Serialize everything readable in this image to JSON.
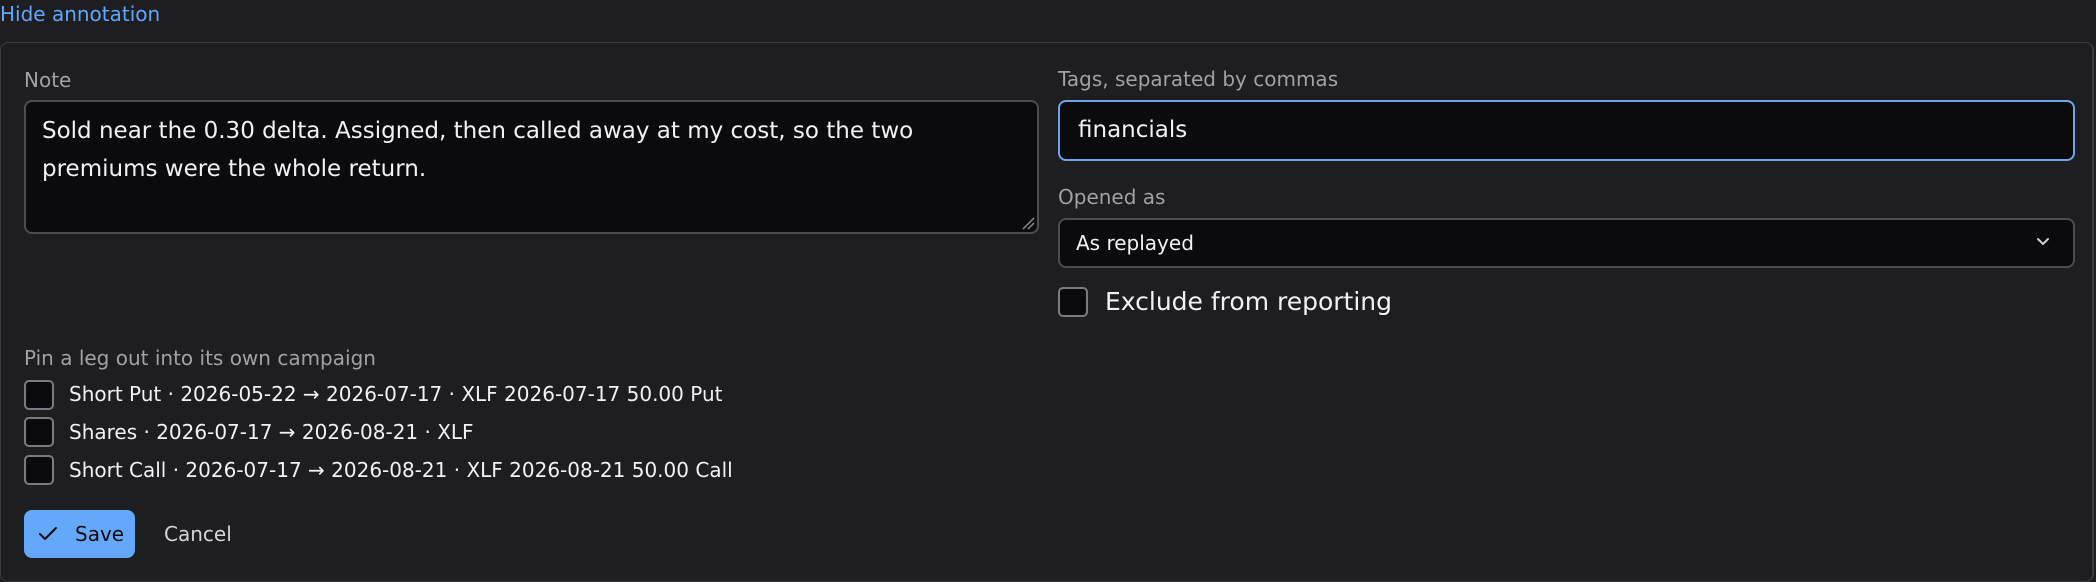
{
  "annotation": {
    "toggle_label": "Hide annotation"
  },
  "note": {
    "label": "Note",
    "value": "Sold near the 0.30 delta. Assigned, then called away at my cost, so the two premiums were the whole return."
  },
  "tags": {
    "label": "Tags, separated by commas",
    "value": "financials"
  },
  "opened_as": {
    "label": "Opened as",
    "selected": "As replayed"
  },
  "exclude": {
    "label": "Exclude from reporting",
    "checked": false
  },
  "pin_legs": {
    "label": "Pin a leg out into its own campaign",
    "items": [
      {
        "label": "Short Put · 2026-05-22 → 2026-07-17 · XLF 2026-07-17 50.00 Put",
        "checked": false
      },
      {
        "label": "Shares · 2026-07-17 → 2026-08-21 · XLF",
        "checked": false
      },
      {
        "label": "Short Call · 2026-07-17 → 2026-08-21 · XLF 2026-08-21 50.00 Call",
        "checked": false
      }
    ]
  },
  "actions": {
    "save_label": "Save",
    "cancel_label": "Cancel"
  },
  "icons": {
    "save": "check-icon",
    "select": "chevron-down-icon",
    "textarea": "resize-grip-icon"
  },
  "colors": {
    "accent": "#64a8fb",
    "link": "#5fa6ff",
    "focus_border": "#6ea5ea",
    "background": "#1e1e21",
    "field_background": "#0b0b0e"
  }
}
